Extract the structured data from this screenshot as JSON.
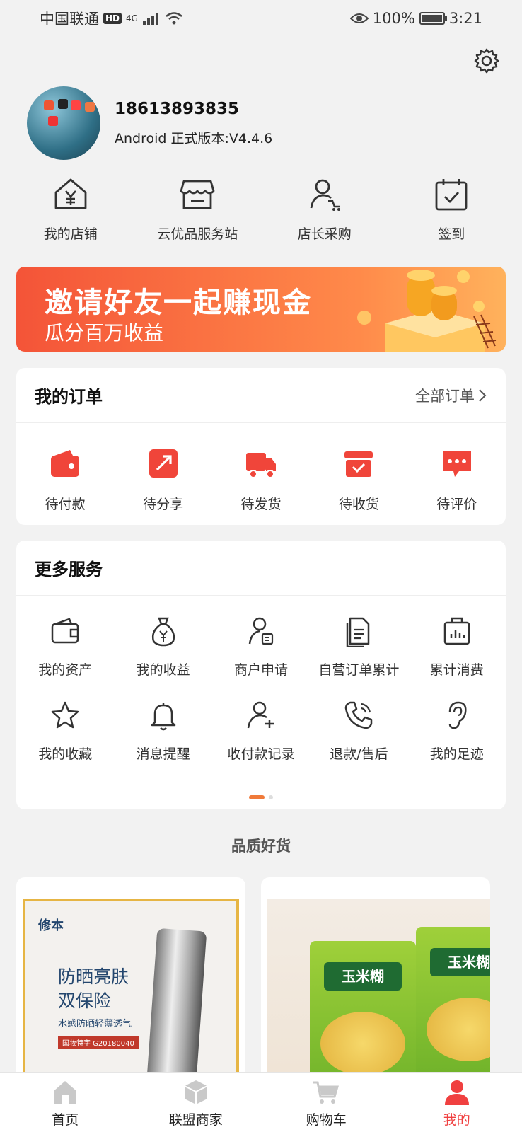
{
  "status_bar": {
    "carrier": "中国联通",
    "hd": "HD",
    "network": "4G",
    "battery": "100%",
    "time": "3:21"
  },
  "profile": {
    "phone": "18613893835",
    "version": "Android 正式版本:V4.4.6"
  },
  "quick_actions": [
    {
      "label": "我的店铺",
      "icon": "store-yen-icon"
    },
    {
      "label": "云优品服务站",
      "icon": "shop-awning-icon"
    },
    {
      "label": "店长采购",
      "icon": "person-cart-icon"
    },
    {
      "label": "签到",
      "icon": "calendar-check-icon"
    }
  ],
  "banner": {
    "title": "邀请好友一起赚现金",
    "subtitle": "瓜分百万收益"
  },
  "orders": {
    "title": "我的订单",
    "all_link": "全部订单",
    "items": [
      {
        "label": "待付款",
        "icon": "wallet-icon"
      },
      {
        "label": "待分享",
        "icon": "share-icon"
      },
      {
        "label": "待发货",
        "icon": "truck-icon"
      },
      {
        "label": "待收货",
        "icon": "box-check-icon"
      },
      {
        "label": "待评价",
        "icon": "comment-icon"
      }
    ]
  },
  "services": {
    "title": "更多服务",
    "items": [
      {
        "label": "我的资产",
        "icon": "wallet-outline-icon"
      },
      {
        "label": "我的收益",
        "icon": "money-bag-icon"
      },
      {
        "label": "商户申请",
        "icon": "person-doc-icon"
      },
      {
        "label": "自营订单累计",
        "icon": "document-icon"
      },
      {
        "label": "累计消费",
        "icon": "bag-chart-icon"
      },
      {
        "label": "我的收藏",
        "icon": "star-icon"
      },
      {
        "label": "消息提醒",
        "icon": "bell-icon"
      },
      {
        "label": "收付款记录",
        "icon": "person-add-icon"
      },
      {
        "label": "退款/售后",
        "icon": "phone-icon"
      },
      {
        "label": "我的足迹",
        "icon": "ear-icon"
      }
    ]
  },
  "featured": {
    "title": "品质好货",
    "product1": {
      "brand": "修本",
      "headline1": "防晒亮肤",
      "headline2": "双保险",
      "subline": "水感防晒轻薄透气",
      "cert": "国妆特字 G20180040"
    },
    "product2": {
      "label": "玉米糊"
    }
  },
  "tabbar": [
    {
      "label": "首页",
      "icon": "home-icon"
    },
    {
      "label": "联盟商家",
      "icon": "cube-icon"
    },
    {
      "label": "购物车",
      "icon": "cart-icon"
    },
    {
      "label": "我的",
      "icon": "user-icon"
    }
  ],
  "colors": {
    "accent": "#f04040",
    "icon_red": "#f0453a",
    "banner_start": "#f45438",
    "banner_end": "#ffb25c"
  }
}
